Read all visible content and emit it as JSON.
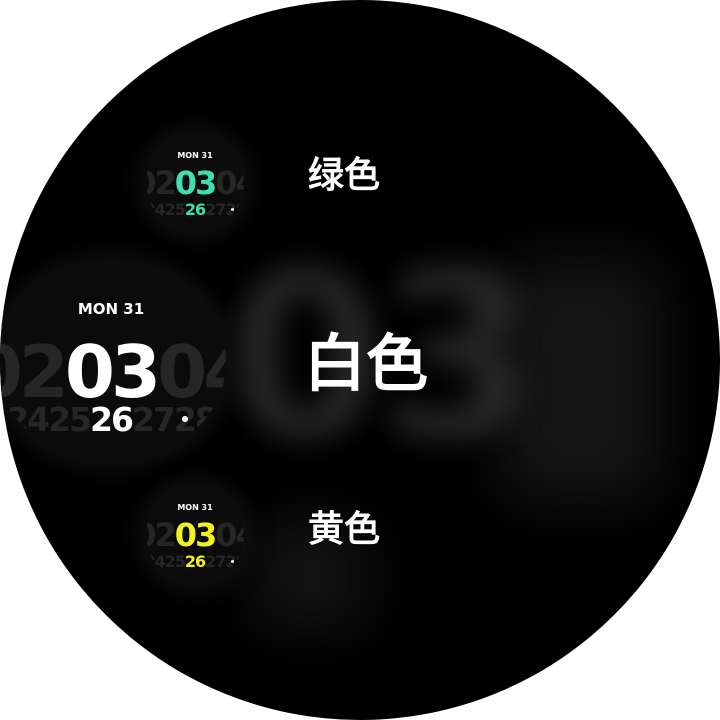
{
  "background_digits": "03",
  "accent_colors": {
    "green": "#3fe0b0",
    "white": "#ffffff",
    "yellow": "#f2f21c"
  },
  "faces": [
    {
      "id": "green",
      "date": "MON 31",
      "hour_prev": "02",
      "hour": "03",
      "hour_next": "04",
      "min_prev": "25",
      "minute": "26",
      "min_next": "27",
      "min_prev2": "24",
      "min_next2": "28",
      "label": "绿色"
    },
    {
      "id": "white",
      "date": "MON 31",
      "hour_prev": "02",
      "hour": "03",
      "hour_next": "04",
      "min_prev": "25",
      "minute": "26",
      "min_next": "27",
      "min_prev2": "24",
      "min_next2": "28",
      "label": "白色"
    },
    {
      "id": "yellow",
      "date": "MON 31",
      "hour_prev": "02",
      "hour": "03",
      "hour_next": "04",
      "min_prev": "25",
      "minute": "26",
      "min_next": "27",
      "min_prev2": "24",
      "min_next2": "28",
      "label": "黄色"
    }
  ]
}
